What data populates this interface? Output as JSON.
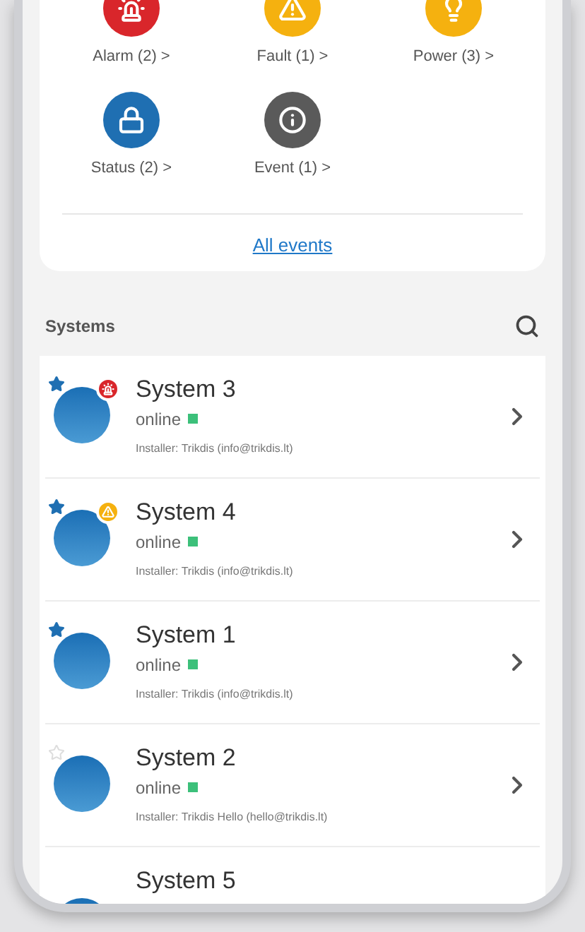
{
  "events": [
    {
      "kind": "alarm",
      "label": "Alarm (2) >"
    },
    {
      "kind": "fault",
      "label": "Fault (1) >"
    },
    {
      "kind": "power",
      "label": "Power (3) >"
    },
    {
      "kind": "status",
      "label": "Status (2) >"
    },
    {
      "kind": "event",
      "label": "Event (1) >"
    }
  ],
  "all_events_link": "All events",
  "systems_header": {
    "title": "Systems"
  },
  "systems": [
    {
      "kind": "alarm",
      "name": "System 3",
      "favorite": true,
      "status": "online",
      "color": "#3cc07a",
      "installer": "Installer: Trikdis (info@trikdis.lt)"
    },
    {
      "kind": "fault",
      "name": "System 4",
      "favorite": true,
      "status": "online",
      "color": "#3cc07a",
      "installer": "Installer: Trikdis (info@trikdis.lt)"
    },
    {
      "kind": "plain",
      "name": "System 1",
      "favorite": true,
      "status": "online",
      "color": "#3cc07a",
      "installer": "Installer: Trikdis (info@trikdis.lt)"
    },
    {
      "kind": "plain",
      "name": "System 2",
      "favorite": false,
      "status": "online",
      "color": "#3cc07a",
      "installer": "Installer: Trikdis Hello (hello@trikdis.lt)"
    },
    {
      "kind": "plain",
      "name": "System 5"
    }
  ]
}
